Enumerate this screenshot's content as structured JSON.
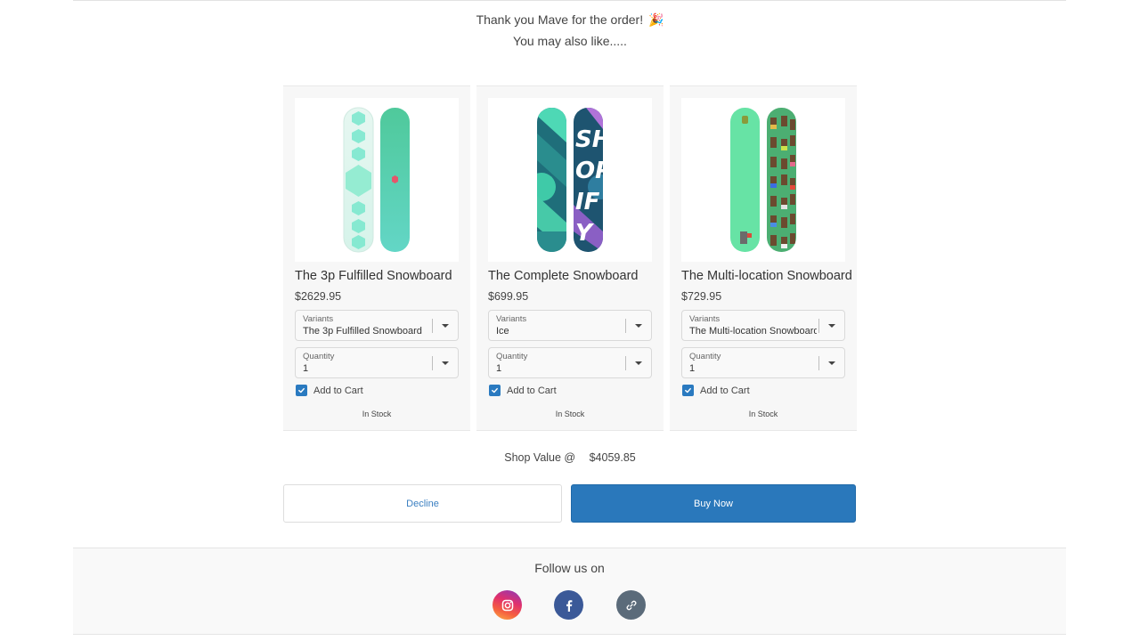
{
  "header": {
    "thanks": "Thank you Mave for the order!",
    "party_icon": "🎉",
    "subtitle": "You may also like....."
  },
  "products": [
    {
      "title": "The 3p Fulfilled Snowboard",
      "price": "$2629.95",
      "image_icon": "snowboard-mint-hexagon",
      "variants_label": "Variants",
      "variant_value": "The 3p Fulfilled Snowboard",
      "quantity_label": "Quantity",
      "quantity_value": "1",
      "add_to_cart_label": "Add to Cart",
      "add_to_cart_checked": true,
      "stock": "In Stock"
    },
    {
      "title": "The Complete Snowboard",
      "price": "$699.95",
      "image_icon": "snowboard-shopify-teal-purple",
      "variants_label": "Variants",
      "variant_value": "Ice",
      "quantity_label": "Quantity",
      "quantity_value": "1",
      "add_to_cart_label": "Add to Cart",
      "add_to_cart_checked": true,
      "stock": "In Stock"
    },
    {
      "title": "The Multi-location Snowboard",
      "price": "$729.95",
      "image_icon": "snowboard-green-pixel-people",
      "variants_label": "Variants",
      "variant_value": "The Multi-location Snowboard",
      "quantity_label": "Quantity",
      "quantity_value": "1",
      "add_to_cart_label": "Add to Cart",
      "add_to_cart_checked": true,
      "stock": "In Stock"
    }
  ],
  "summary": {
    "shop_value_label": "Shop Value @",
    "shop_value_amount": "$4059.85"
  },
  "actions": {
    "decline_label": "Decline",
    "buy_label": "Buy Now"
  },
  "footer": {
    "follow_label": "Follow us on",
    "socials": [
      "instagram-icon",
      "facebook-icon",
      "link-icon"
    ]
  },
  "colors": {
    "primary": "#2a78bb",
    "checkbox": "#2a7ac0",
    "facebook": "#3b5998",
    "link": "#5b6b7a"
  }
}
